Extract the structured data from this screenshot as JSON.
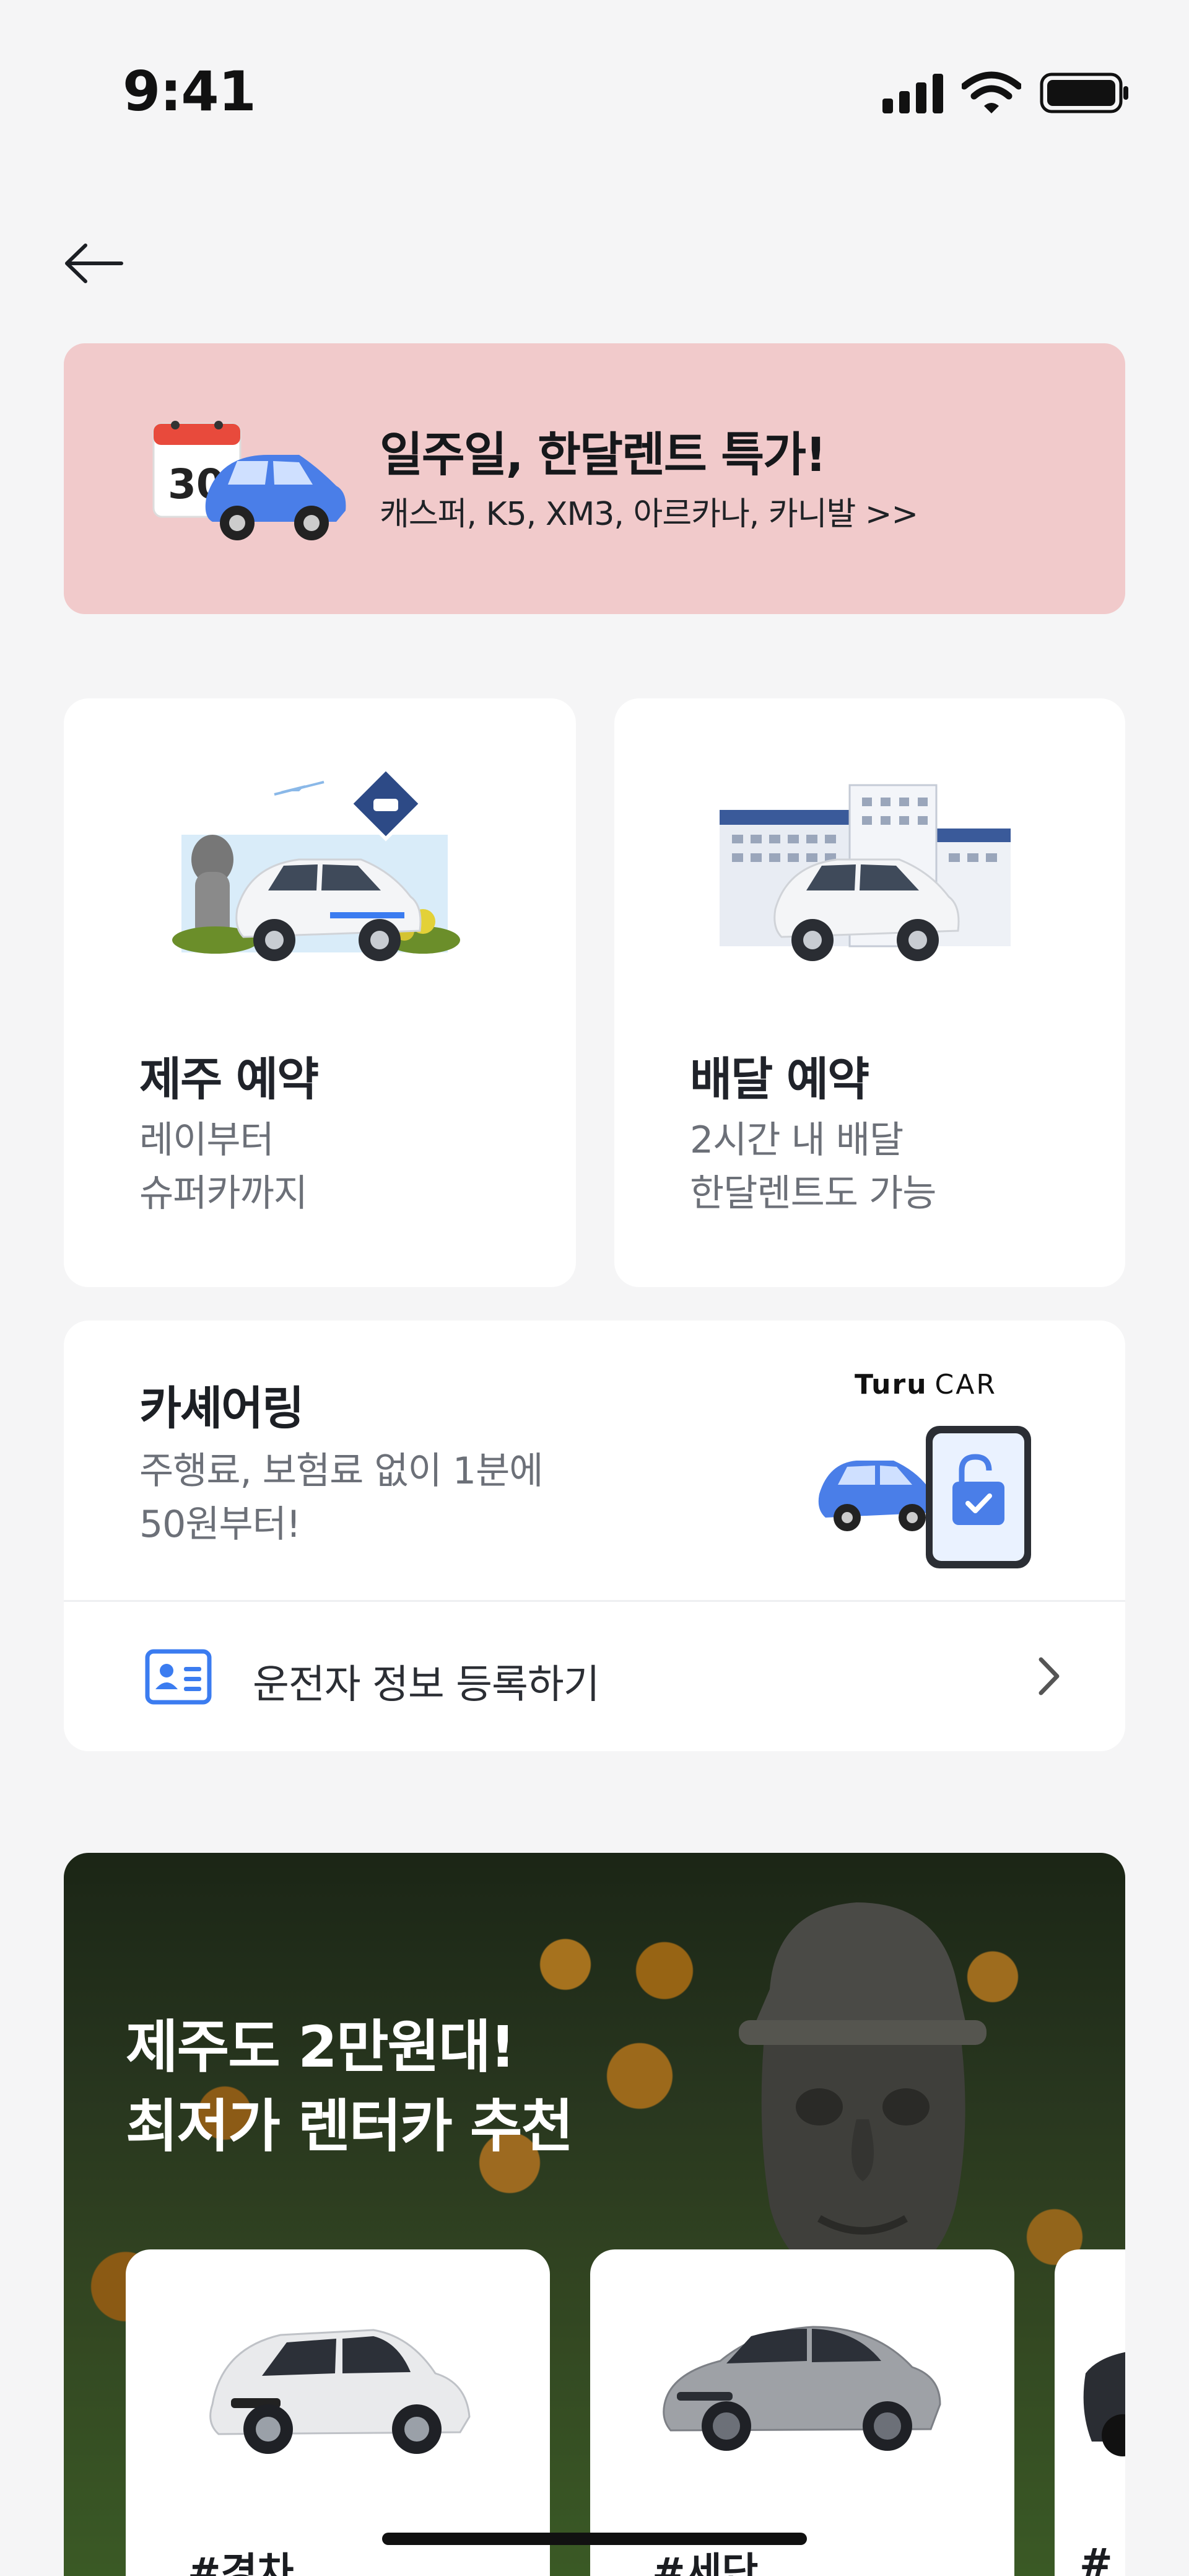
{
  "status_bar": {
    "time": "9:41",
    "icons": [
      "signal-icon",
      "wifi-icon",
      "battery-icon"
    ]
  },
  "nav": {
    "back_icon": "arrow-left-icon"
  },
  "banner": {
    "title": "일주일, 한달렌트 특가!",
    "subtitle": "캐스퍼, K5, XM3, 아르카나, 카니발 >>",
    "calendar_number": "30",
    "background": "#f1cacb"
  },
  "services": [
    {
      "title": "제주 예약",
      "desc_line1": "레이부터",
      "desc_line2": "슈퍼카까지"
    },
    {
      "title": "배달 예약",
      "desc_line1": "2시간 내 배달",
      "desc_line2": "한달렌트도 가능"
    }
  ],
  "car_sharing": {
    "title": "카셰어링",
    "desc_line1": "주행료, 보험료 없이 1분에",
    "desc_line2": "50원부터!",
    "logo_main": "Turu",
    "logo_sub": "CAR",
    "driver_register_label": "운전자 정보 등록하기"
  },
  "promo": {
    "title_line1": "제주도 2만원대!",
    "title_line2": "최저가 렌터카 추천",
    "cars": [
      {
        "tag": "#경차"
      },
      {
        "tag": "#세단"
      },
      {
        "tag": "#"
      }
    ]
  },
  "colors": {
    "accent_blue": "#3b7cf0",
    "banner_pink": "#f1cacb",
    "text_secondary": "#6c7078"
  }
}
